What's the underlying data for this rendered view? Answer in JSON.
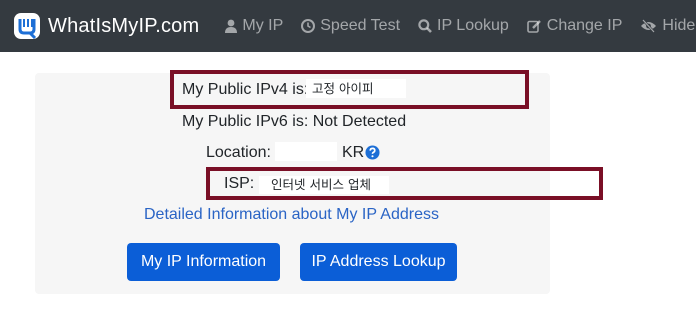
{
  "navbar": {
    "brand": "WhatIsMyIP.com",
    "items": [
      {
        "label": "My IP",
        "icon": "user-icon"
      },
      {
        "label": "Speed Test",
        "icon": "clock-icon"
      },
      {
        "label": "IP Lookup",
        "icon": "search-icon"
      },
      {
        "label": "Change IP",
        "icon": "edit-icon"
      },
      {
        "label": "Hide IP",
        "icon": "eye-slash-icon"
      }
    ]
  },
  "info": {
    "ipv4_label": "My Public IPv4 is:",
    "ipv4_value": "고정 아이피",
    "ipv6_text": "My Public IPv6 is: Not Detected",
    "location_label": "Location:",
    "location_value": "KR",
    "isp_label": "ISP:",
    "isp_value": "인터넷 서비스 업체",
    "detail_link": "Detailed Information about My IP Address"
  },
  "buttons": {
    "my_ip_info": "My IP Information",
    "ip_lookup": "IP Address Lookup"
  },
  "colors": {
    "navbar_bg": "#343a40",
    "card_bg": "#f6f6f6",
    "highlight_border": "#7a0f26",
    "link": "#2a64c5",
    "button_bg": "#0b5ed7"
  }
}
